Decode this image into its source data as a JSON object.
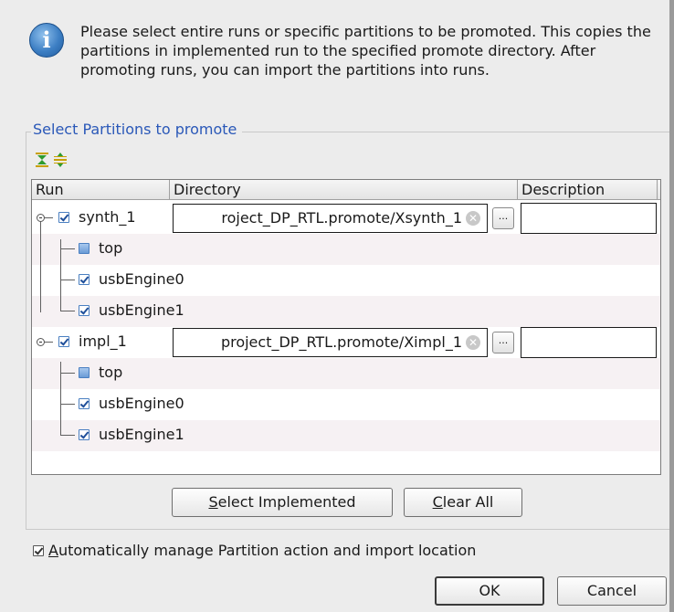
{
  "info": {
    "icon": "info-icon",
    "message": "Please select entire runs or specific partitions to be promoted. This copies the partitions in implemented run to the specified promote directory. After promoting runs, you can import the partitions into runs."
  },
  "group": {
    "title": "Select Partitions to promote",
    "toolbar": {
      "expand_icon": "expand-all-icon",
      "collapse_icon": "collapse-all-icon"
    }
  },
  "table": {
    "columns": [
      "Run",
      "Directory",
      "Description"
    ],
    "runs": [
      {
        "name": "synth_1",
        "checked": true,
        "directory": "roject_DP_RTL.promote/Xsynth_1",
        "description": "",
        "browse_label": "...",
        "partitions": [
          {
            "name": "top",
            "state": "partial"
          },
          {
            "name": "usbEngine0",
            "state": "checked"
          },
          {
            "name": "usbEngine1",
            "state": "checked"
          }
        ]
      },
      {
        "name": "impl_1",
        "checked": true,
        "directory": "project_DP_RTL.promote/Ximpl_1",
        "description": "",
        "browse_label": "...",
        "partitions": [
          {
            "name": "top",
            "state": "partial"
          },
          {
            "name": "usbEngine0",
            "state": "checked"
          },
          {
            "name": "usbEngine1",
            "state": "checked"
          }
        ]
      }
    ]
  },
  "buttons": {
    "select_implemented": {
      "mnemonic": "S",
      "rest": "elect Implemented"
    },
    "clear_all": {
      "mnemonic": "C",
      "rest": "lear All"
    },
    "ok": "OK",
    "cancel": "Cancel"
  },
  "auto_manage": {
    "checked": true,
    "mnemonic": "A",
    "rest": "utomatically manage Partition action and import location"
  },
  "colors": {
    "accent": "#2a58b8",
    "row_alt": "#f6f1f3"
  }
}
